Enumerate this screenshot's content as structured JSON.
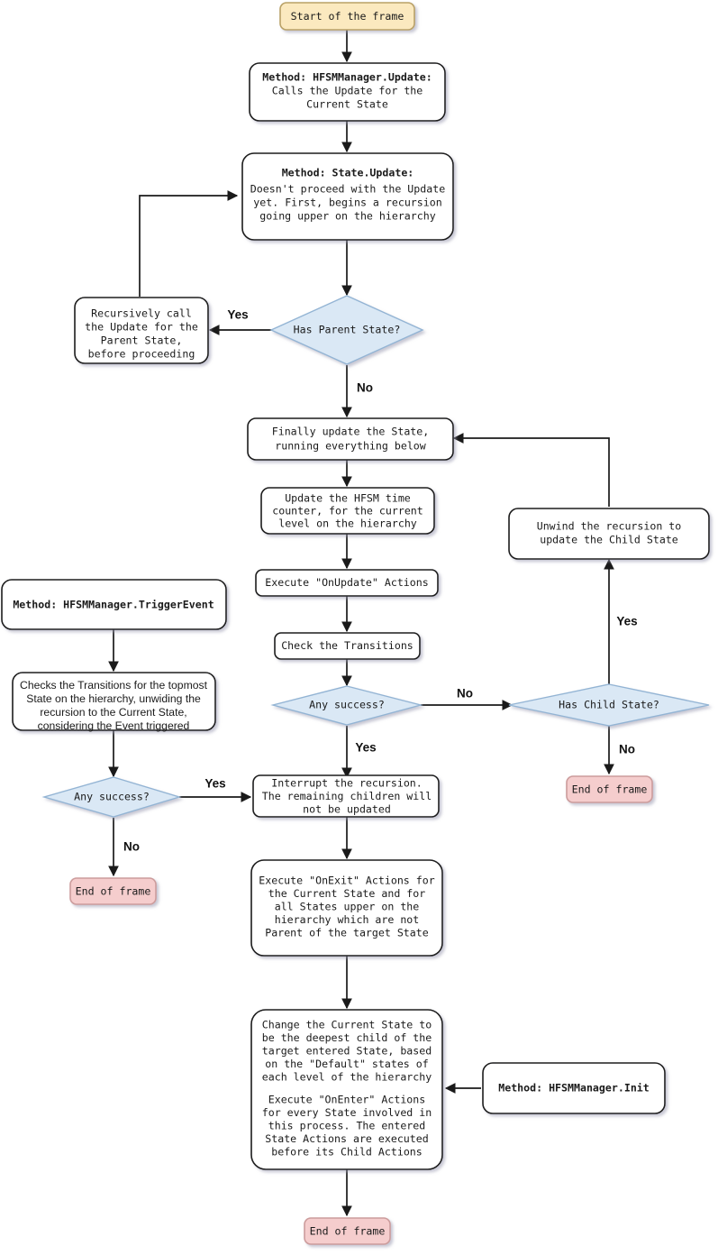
{
  "diagram": {
    "title": "HFSM frame update flowchart",
    "colors": {
      "start_fill": "#fbe9bf",
      "start_stroke": "#b9a166",
      "end_fill": "#f5cdcd",
      "end_stroke": "#cc9c9c",
      "decision_fill": "#dae8f5",
      "decision_stroke": "#93b4d4",
      "process_fill": "#ffffff",
      "process_stroke": "#1a1a1a",
      "edge": "#1a1a1a",
      "background": "#ffffff"
    },
    "nodes": {
      "start_frame": {
        "kind": "terminator-start",
        "lines": [
          "Start of the frame"
        ]
      },
      "hfsm_update": {
        "kind": "process",
        "lines": [
          "Method: HFSMManager.Update:",
          "Calls the Update for the",
          "Current State"
        ],
        "bold_lines": [
          0
        ]
      },
      "state_update": {
        "kind": "process",
        "lines": [
          "Method: State.Update:",
          "Doesn't proceed with the Update",
          "yet. First, begins a recursion",
          "going upper on the hierarchy"
        ],
        "bold_lines": [
          0
        ]
      },
      "has_parent": {
        "kind": "decision",
        "lines": [
          "Has Parent State?"
        ]
      },
      "recursive_parent": {
        "kind": "process",
        "lines": [
          "Recursively call",
          "the Update for the",
          "Parent State,",
          "before proceeding"
        ]
      },
      "finally_update": {
        "kind": "process",
        "lines": [
          "Finally update the State,",
          "running everything below"
        ]
      },
      "update_time": {
        "kind": "process",
        "lines": [
          "Update the HFSM time",
          "counter, for the current",
          "level on the hierarchy"
        ]
      },
      "onupdate_actions": {
        "kind": "process",
        "lines": [
          "Execute \"OnUpdate\" Actions"
        ]
      },
      "check_transitions": {
        "kind": "process",
        "lines": [
          "Check the Transitions"
        ]
      },
      "any_success_update": {
        "kind": "decision",
        "lines": [
          "Any success?"
        ]
      },
      "has_child": {
        "kind": "decision",
        "lines": [
          "Has Child State?"
        ]
      },
      "unwind_recursion": {
        "kind": "process",
        "lines": [
          "Unwind the recursion to",
          "update the Child State"
        ]
      },
      "end_frame_child": {
        "kind": "terminator-end",
        "lines": [
          "End of frame"
        ]
      },
      "trigger_event": {
        "kind": "process",
        "lines": [
          "Method: HFSMManager.TriggerEvent"
        ],
        "bold_lines": [
          0
        ]
      },
      "checks_transitions_topmost": {
        "kind": "process",
        "font": "sans",
        "lines": [
          "Checks the Transitions for the topmost",
          "State on the hierarchy, unwiding the",
          "recursion to the Current State,",
          "considering the Event triggered"
        ]
      },
      "any_success_event": {
        "kind": "decision",
        "lines": [
          "Any success?"
        ]
      },
      "end_frame_event": {
        "kind": "terminator-end",
        "lines": [
          "End of frame"
        ]
      },
      "interrupt_recursion": {
        "kind": "process",
        "lines": [
          "Interrupt the recursion.",
          "The remaining children will",
          "not be updated"
        ]
      },
      "onexit_actions": {
        "kind": "process",
        "lines": [
          "Execute \"OnExit\" Actions for",
          "the Current State and for",
          "all States upper on the",
          "hierarchy which are not",
          "Parent of the target State"
        ]
      },
      "change_current_state": {
        "kind": "process",
        "lines": [
          "Change the Current State to",
          "be the deepest child of the",
          "target entered State, based",
          "on the \"Default\" states of",
          "each level of the hierarchy",
          "",
          "Execute \"OnEnter\" Actions",
          "for every State involved in",
          "this process. The entered",
          "State Actions are executed",
          "before its Child Actions"
        ]
      },
      "hfsm_init": {
        "kind": "process",
        "lines": [
          "Method: HFSMManager.Init"
        ],
        "bold_lines": [
          0
        ]
      },
      "end_frame_final": {
        "kind": "terminator-end",
        "lines": [
          "End of frame"
        ]
      }
    },
    "edge_labels": {
      "parent_yes": "Yes",
      "parent_no": "No",
      "update_success_no": "No",
      "update_success_yes": "Yes",
      "child_yes": "Yes",
      "child_no": "No",
      "event_success_yes": "Yes",
      "event_success_no": "No"
    }
  }
}
